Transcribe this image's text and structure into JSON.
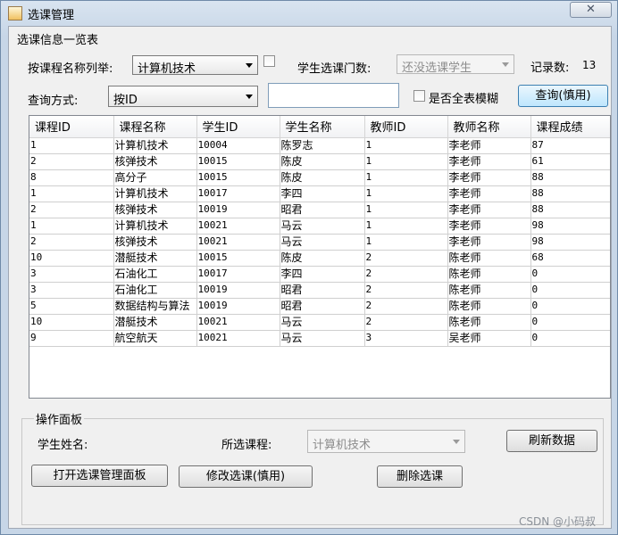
{
  "window": {
    "title": "选课管理",
    "close_glyph": "✕"
  },
  "info_group": {
    "title": "选课信息一览表"
  },
  "filter": {
    "list_by_label": "按课程名称列举:",
    "course_selected": "计算机技术",
    "count_label": "学生选课门数:",
    "count_selected": "还没选课学生",
    "records_label": "记录数:",
    "records_value": "13",
    "query_mode_label": "查询方式:",
    "query_mode_selected": "按ID",
    "query_text": "",
    "fuzzy_label": "是否全表模糊",
    "query_button": "查询(慎用)"
  },
  "table": {
    "columns": [
      "课程ID",
      "课程名称",
      "学生ID",
      "学生名称",
      "教师ID",
      "教师名称",
      "课程成绩"
    ],
    "rows": [
      [
        "1",
        "计算机技术",
        "10004",
        "陈罗志",
        "1",
        "李老师",
        "87"
      ],
      [
        "2",
        "核弹技术",
        "10015",
        "陈皮",
        "1",
        "李老师",
        "61"
      ],
      [
        "8",
        "高分子",
        "10015",
        "陈皮",
        "1",
        "李老师",
        "88"
      ],
      [
        "1",
        "计算机技术",
        "10017",
        "李四",
        "1",
        "李老师",
        "88"
      ],
      [
        "2",
        "核弹技术",
        "10019",
        "昭君",
        "1",
        "李老师",
        "88"
      ],
      [
        "1",
        "计算机技术",
        "10021",
        "马云",
        "1",
        "李老师",
        "98"
      ],
      [
        "2",
        "核弹技术",
        "10021",
        "马云",
        "1",
        "李老师",
        "98"
      ],
      [
        "10",
        "潜艇技术",
        "10015",
        "陈皮",
        "2",
        "陈老师",
        "68"
      ],
      [
        "3",
        "石油化工",
        "10017",
        "李四",
        "2",
        "陈老师",
        "0"
      ],
      [
        "3",
        "石油化工",
        "10019",
        "昭君",
        "2",
        "陈老师",
        "0"
      ],
      [
        "5",
        "数据结构与算法",
        "10019",
        "昭君",
        "2",
        "陈老师",
        "0"
      ],
      [
        "10",
        "潜艇技术",
        "10021",
        "马云",
        "2",
        "陈老师",
        "0"
      ],
      [
        "9",
        "航空航天",
        "10021",
        "马云",
        "3",
        "吴老师",
        "0"
      ]
    ]
  },
  "ops": {
    "title": "操作面板",
    "student_name_label": "学生姓名:",
    "course_label": "所选课程:",
    "course_selected": "计算机技术",
    "refresh_button": "刷新数据",
    "open_panel_button": "打开选课管理面板",
    "modify_button": "修改选课(慎用)",
    "delete_button": "删除选课"
  },
  "watermark": "CSDN @小码叔"
}
